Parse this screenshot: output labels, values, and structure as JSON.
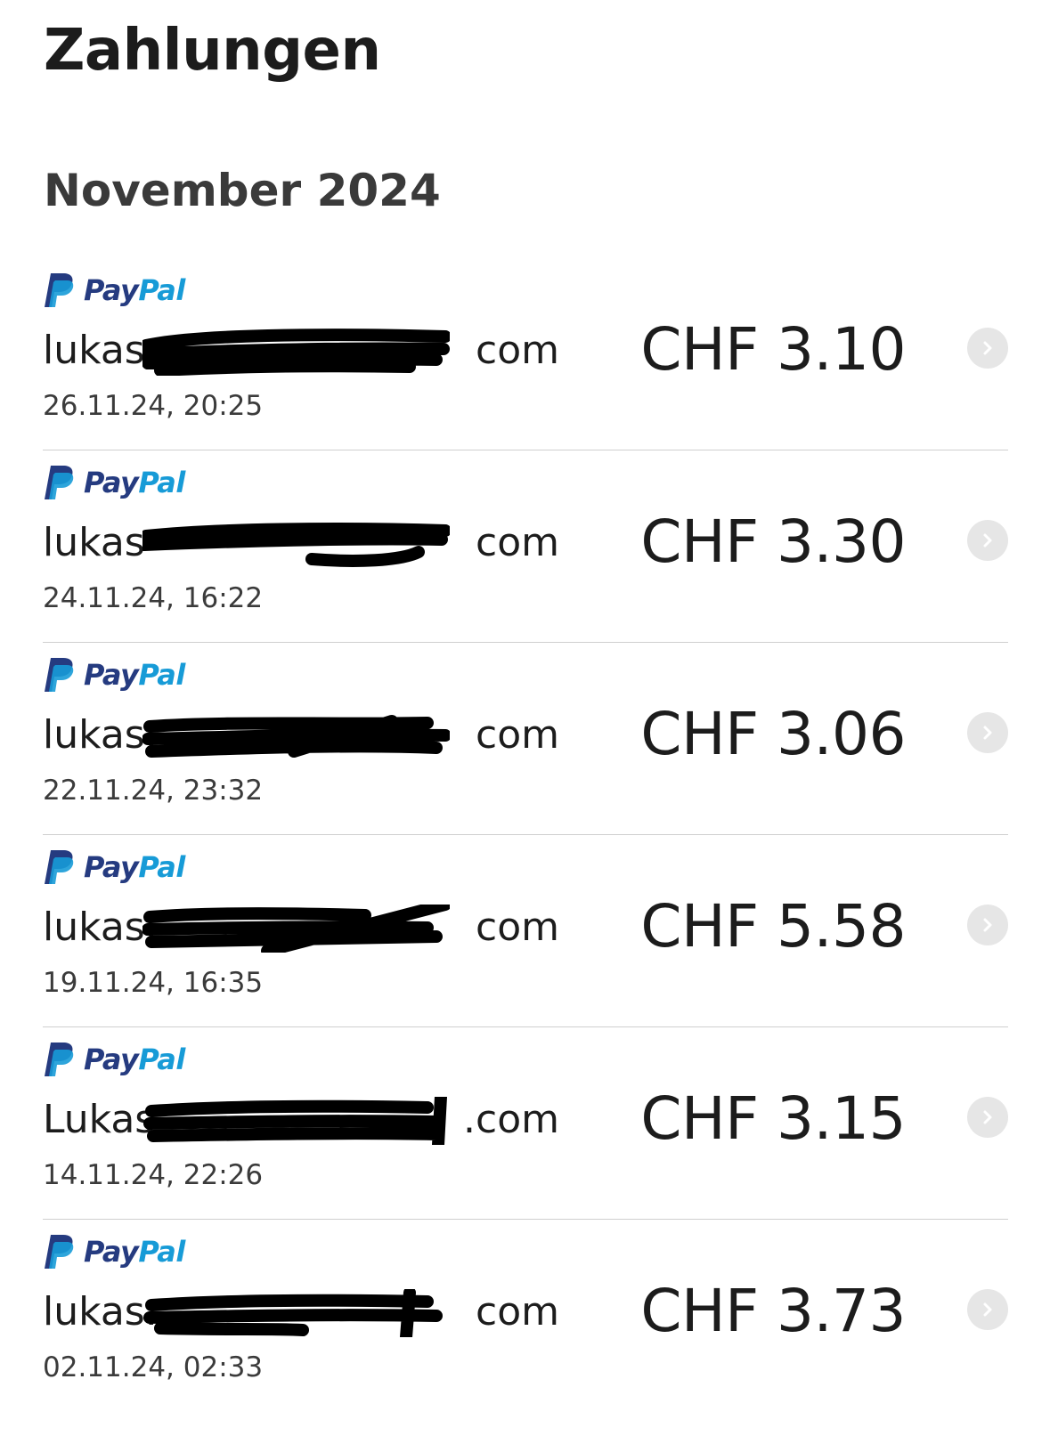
{
  "page": {
    "title": "Zahlungen"
  },
  "section": {
    "month": "November 2024"
  },
  "brand": {
    "pay": "Pay",
    "pal": "Pal",
    "icon": "paypal-logo"
  },
  "colors": {
    "paypal_dark": "#253b80",
    "paypal_light": "#179bd7",
    "chevron_bg": "#e6e6e6"
  },
  "payments": [
    {
      "email_prefix": "lukas",
      "email_suffix": "com",
      "date": "26.11.24, 20:25",
      "amount": "CHF 3.10"
    },
    {
      "email_prefix": "lukas",
      "email_suffix": "com",
      "date": "24.11.24, 16:22",
      "amount": "CHF 3.30"
    },
    {
      "email_prefix": "lukas.",
      "email_suffix": "com",
      "date": "22.11.24, 23:32",
      "amount": "CHF 3.06"
    },
    {
      "email_prefix": "lukas.",
      "email_suffix": "com",
      "date": "19.11.24, 16:35",
      "amount": "CHF 5.58"
    },
    {
      "email_prefix": "Lukas",
      "email_suffix": ".com",
      "date": "14.11.24, 22:26",
      "amount": "CHF 3.15"
    },
    {
      "email_prefix": "lukas.",
      "email_suffix": "com",
      "date": "02.11.24, 02:33",
      "amount": "CHF 3.73"
    }
  ]
}
